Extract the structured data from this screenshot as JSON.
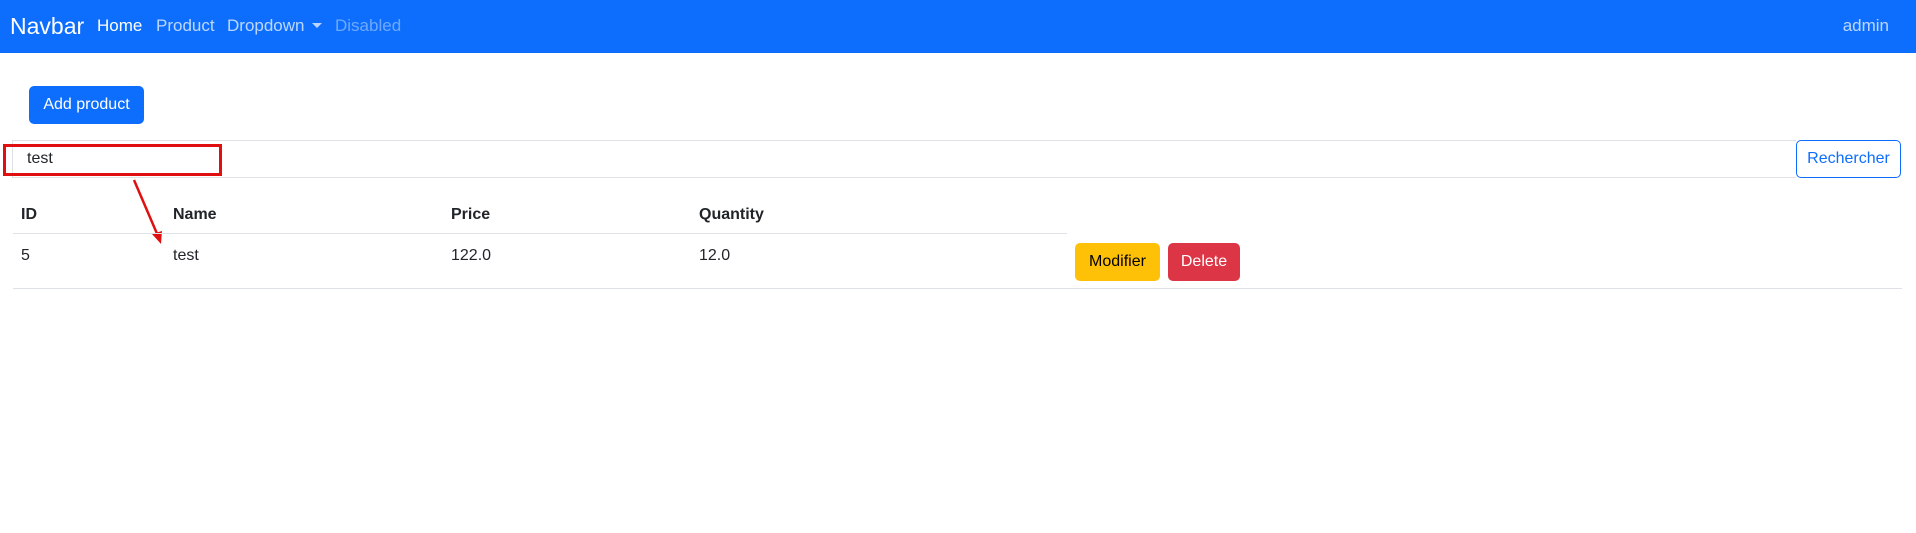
{
  "navbar": {
    "brand": "Navbar",
    "links": [
      {
        "label": "Home",
        "state": "active"
      },
      {
        "label": "Product",
        "state": "normal"
      },
      {
        "label": "Dropdown",
        "state": "dropdown"
      },
      {
        "label": "Disabled",
        "state": "disabled"
      }
    ],
    "user": "admin",
    "color": "#0d6efd"
  },
  "actions": {
    "add_label": "Add product"
  },
  "search": {
    "value": "test",
    "button_label": "Rechercher"
  },
  "table": {
    "headers": [
      "ID",
      "Name",
      "Price",
      "Quantity"
    ],
    "rows": [
      {
        "id": "5",
        "name": "test",
        "price": "122.0",
        "quantity": "12.0",
        "modify_label": "Modifier",
        "delete_label": "Delete"
      }
    ]
  },
  "colors": {
    "primary": "#0d6efd",
    "warning": "#ffc107",
    "danger": "#dc3545",
    "annotation": "#e01010"
  }
}
